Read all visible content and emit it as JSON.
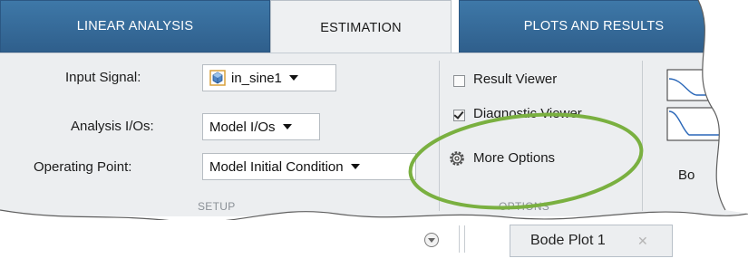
{
  "tabs": [
    {
      "label": "LINEAR ANALYSIS",
      "active": false
    },
    {
      "label": "ESTIMATION",
      "active": true
    },
    {
      "label": "PLOTS AND RESULTS",
      "active": false
    }
  ],
  "setup": {
    "input_signal_label": "Input Signal:",
    "input_signal_value": "in_sine1",
    "analysis_ios_label": "Analysis I/Os:",
    "analysis_ios_value": "Model I/Os",
    "operating_point_label": "Operating Point:",
    "operating_point_value": "Model Initial Condition",
    "group_label": "SETUP"
  },
  "options": {
    "result_viewer_label": "Result Viewer",
    "result_viewer_checked": false,
    "diagnostic_viewer_label": "Diagnostic Viewer",
    "diagnostic_viewer_checked": true,
    "more_options_label": "More Options",
    "group_label": "OPTIONS"
  },
  "plots": {
    "partial_label": "Bo"
  },
  "document_tabs": [
    {
      "label": "Bode Plot 1"
    }
  ],
  "colors": {
    "tab_blue": "#2f5f8c",
    "ribbon_bg": "#eceef0",
    "highlight_green": "#7ab040"
  },
  "icons": {
    "signal": "signal-cube-icon",
    "more_options": "gear-icon",
    "close": "close-icon",
    "panel_menu": "chevron-down-circle-icon"
  }
}
